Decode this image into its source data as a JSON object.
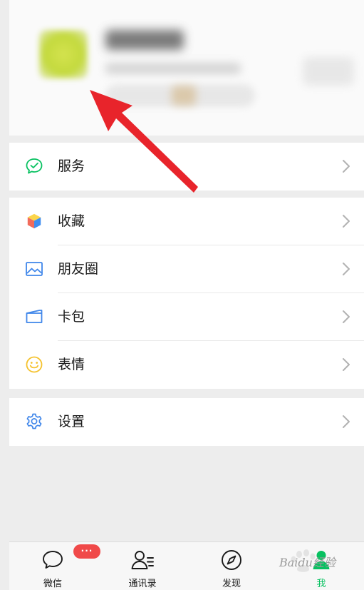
{
  "menu": {
    "services": {
      "label": "服务",
      "icon": "service-icon",
      "color": "#07c160"
    },
    "items": [
      {
        "label": "收藏",
        "icon": "favorites-icon"
      },
      {
        "label": "朋友圈",
        "icon": "moments-icon"
      },
      {
        "label": "卡包",
        "icon": "card-wallet-icon"
      },
      {
        "label": "表情",
        "icon": "sticker-icon"
      }
    ],
    "settings": {
      "label": "设置",
      "icon": "settings-icon"
    }
  },
  "tabbar": {
    "tabs": [
      {
        "label": "微信",
        "icon": "chat-icon",
        "badge": "···"
      },
      {
        "label": "通讯录",
        "icon": "contacts-icon"
      },
      {
        "label": "发现",
        "icon": "compass-icon"
      },
      {
        "label": "我",
        "icon": "me-icon",
        "active": true
      }
    ],
    "active_color": "#07c160"
  },
  "watermark": {
    "text": "Baidu经验"
  },
  "annotation": {
    "arrow_color": "#e8242b"
  }
}
